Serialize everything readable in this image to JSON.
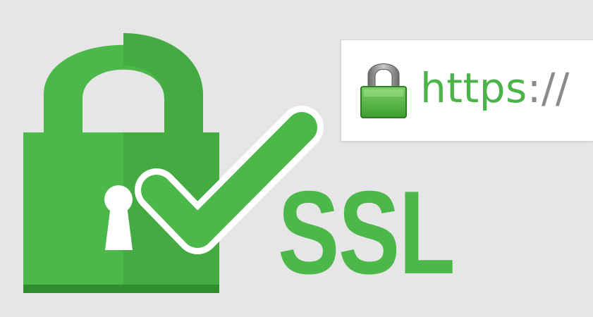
{
  "address_bar": {
    "scheme": "https",
    "separator": "://",
    "lock_icon": "padlock-icon"
  },
  "ssl_label": "SSL",
  "main_graphic": {
    "lock_icon": "padlock-icon",
    "keyhole_icon": "keyhole-icon",
    "check_icon": "checkmark-icon"
  },
  "colors": {
    "background": "#e6e6e6",
    "lock_green_light": "#4cb84a",
    "lock_green_dark": "#3fa53d",
    "lock_base": "#2f8f2e",
    "check_outline": "#ffffff",
    "separator_gray": "#8a8a8a"
  }
}
